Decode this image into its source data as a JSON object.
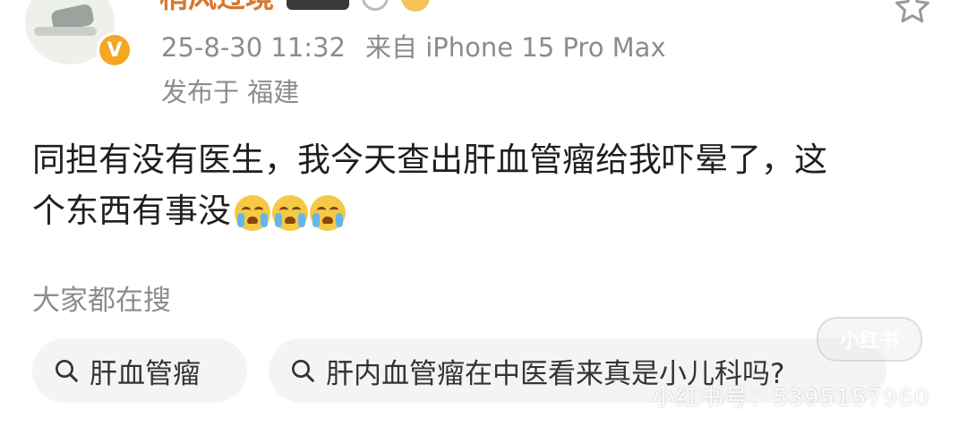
{
  "post": {
    "username": "梢风过境",
    "date": "25-8-30 11:32",
    "source": "来自 iPhone 15 Pro Max",
    "location": "发布于 福建",
    "content_line1": "同担有没有医生，我今天查出肝血管瘤给我吓晕了，这",
    "content_line2": "个东西有事没",
    "emoji": "crying-face"
  },
  "search": {
    "heading": "大家都在搜",
    "chips": [
      {
        "label": "肝血管瘤"
      },
      {
        "label": "肝内血管瘤在中医看来真是小儿科吗?"
      }
    ]
  },
  "watermark": {
    "logo": "小红书",
    "id_text": "小红书号：5395157960"
  },
  "colors": {
    "username": "#d9772b",
    "meta": "#8c8c8c",
    "verify_badge": "#f5a623",
    "chip_bg": "#f4f4f4"
  },
  "icons": [
    "verified-icon",
    "star-icon",
    "search-icon",
    "crying-emoji"
  ]
}
